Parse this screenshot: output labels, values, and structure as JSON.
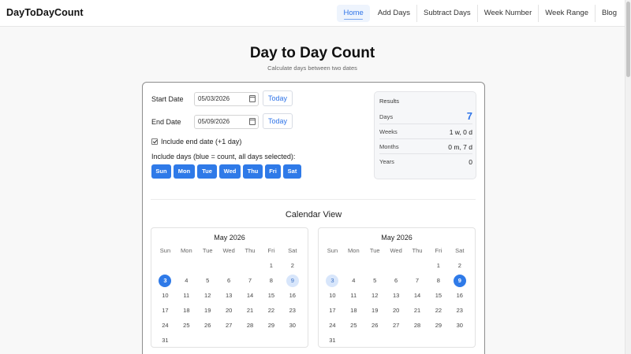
{
  "brand": "DayToDayCount",
  "nav": [
    "Home",
    "Add Days",
    "Subtract Days",
    "Week Number",
    "Week Range",
    "Blog"
  ],
  "page": {
    "title": "Day to Day Count",
    "subtitle": "Calculate days between two dates"
  },
  "form": {
    "start_label": "Start Date",
    "start_value": "05/03/2026",
    "end_label": "End Date",
    "end_value": "05/09/2026",
    "today_label": "Today",
    "include_end_label": "Include end date (+1 day)",
    "include_days_label": "Include days (blue = count, all days selected):",
    "days": [
      "Sun",
      "Mon",
      "Tue",
      "Wed",
      "Thu",
      "Fri",
      "Sat"
    ]
  },
  "results": {
    "title": "Results",
    "rows": [
      {
        "key": "Days",
        "value": "7"
      },
      {
        "key": "Weeks",
        "value": "1 w, 0 d"
      },
      {
        "key": "Months",
        "value": "0 m, 7 d"
      },
      {
        "key": "Years",
        "value": "0"
      }
    ]
  },
  "calendar": {
    "title": "Calendar View",
    "weekdays": [
      "Sun",
      "Mon",
      "Tue",
      "Wed",
      "Thu",
      "Fri",
      "Sat"
    ],
    "months": [
      {
        "title": "May 2026",
        "first_weekday": 5,
        "days_in_month": 31,
        "selected": 3,
        "highlighted": 9
      },
      {
        "title": "May 2026",
        "first_weekday": 5,
        "days_in_month": 31,
        "selected": 9,
        "highlighted": 3
      }
    ]
  },
  "colors": {
    "accent": "#2f7ae8",
    "highlight": "#d8e6fb"
  }
}
